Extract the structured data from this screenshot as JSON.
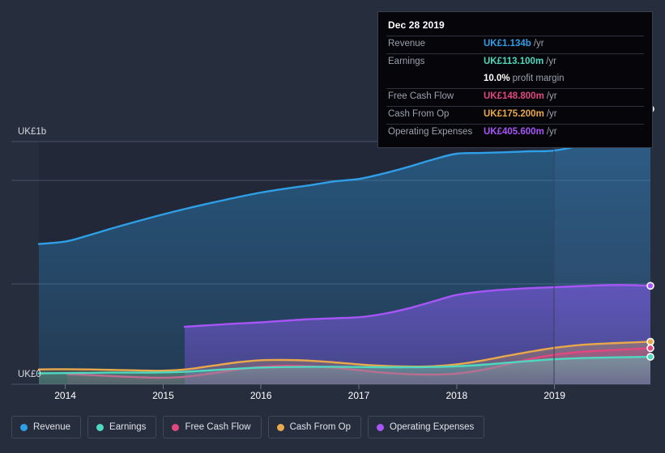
{
  "chart_data": {
    "type": "area",
    "title": "",
    "xlabel": "",
    "ylabel": "",
    "currency": "UK£",
    "x_tick_labels": [
      "2014",
      "2015",
      "2016",
      "2017",
      "2018",
      "2019"
    ],
    "x_tick_values": [
      2014,
      2015,
      2016,
      2017,
      2018,
      2019
    ],
    "y_tick_labels": [
      "UK£0",
      "UK£1b"
    ],
    "y_tick_values": [
      0,
      1000
    ],
    "ylim": [
      0,
      1100
    ],
    "xlim": [
      2013.73,
      2019.98
    ],
    "y_unit": "millions UK£",
    "grid": true,
    "legend_position": "bottom-left",
    "series": [
      {
        "name": "Revenue",
        "color": "#2f9fe8",
        "x": [
          2013.73,
          2014.0,
          2014.25,
          2014.5,
          2014.75,
          2015.0,
          2015.25,
          2015.5,
          2015.75,
          2016.0,
          2016.25,
          2016.5,
          2016.75,
          2017.0,
          2017.25,
          2017.5,
          2017.75,
          2018.0,
          2018.25,
          2018.5,
          2018.75,
          2019.0,
          2019.3,
          2019.65,
          2019.98
        ],
        "values": [
          578,
          588,
          615,
          645,
          673,
          700,
          725,
          748,
          770,
          790,
          806,
          820,
          836,
          846,
          868,
          895,
          925,
          950,
          953,
          956,
          960,
          963,
          990,
          1050,
          1134
        ]
      },
      {
        "name": "Earnings",
        "color": "#4fd8c0",
        "x": [
          2013.73,
          2014.0,
          2014.25,
          2014.5,
          2014.75,
          2015.0,
          2015.25,
          2015.5,
          2015.75,
          2016.0,
          2016.25,
          2016.5,
          2016.75,
          2017.0,
          2017.25,
          2017.5,
          2017.75,
          2018.0,
          2018.25,
          2018.5,
          2018.75,
          2019.0,
          2019.3,
          2019.65,
          2019.98
        ],
        "values": [
          45,
          46,
          47,
          48,
          48,
          49,
          52,
          58,
          64,
          69,
          71,
          72,
          72,
          71,
          70,
          70,
          71,
          74,
          80,
          88,
          96,
          103,
          108,
          111,
          113.1
        ]
      },
      {
        "name": "Free Cash Flow",
        "color": "#e0487f",
        "x": [
          2014.02,
          2014.25,
          2014.5,
          2014.75,
          2015.0,
          2015.25,
          2015.5,
          2015.75,
          2016.0,
          2016.25,
          2016.5,
          2016.75,
          2017.0,
          2017.25,
          2017.5,
          2017.75,
          2018.0,
          2018.25,
          2018.5,
          2018.75,
          2019.0,
          2019.3,
          2019.65,
          2019.98
        ],
        "values": [
          42,
          38,
          33,
          29,
          27,
          32,
          45,
          60,
          72,
          76,
          74,
          68,
          58,
          48,
          42,
          40,
          44,
          58,
          80,
          104,
          122,
          134,
          142,
          148.8
        ]
      },
      {
        "name": "Cash From Op",
        "color": "#e8a84b",
        "x": [
          2013.73,
          2014.0,
          2014.25,
          2014.5,
          2014.75,
          2015.0,
          2015.25,
          2015.5,
          2015.75,
          2016.0,
          2016.25,
          2016.5,
          2016.75,
          2017.0,
          2017.25,
          2017.5,
          2017.75,
          2018.0,
          2018.25,
          2018.5,
          2018.75,
          2019.0,
          2019.3,
          2019.65,
          2019.98
        ],
        "values": [
          61,
          62,
          61,
          59,
          57,
          56,
          62,
          76,
          90,
          99,
          100,
          97,
          90,
          82,
          76,
          73,
          74,
          82,
          97,
          116,
          134,
          150,
          163,
          170,
          175.2
        ]
      },
      {
        "name": "Operating Expenses",
        "color": "#a855f7",
        "x": [
          2015.22,
          2015.5,
          2015.75,
          2016.0,
          2016.25,
          2016.5,
          2016.75,
          2017.0,
          2017.25,
          2017.5,
          2017.75,
          2018.0,
          2018.25,
          2018.5,
          2018.75,
          2019.0,
          2019.3,
          2019.65,
          2019.98
        ],
        "values": [
          237,
          244,
          250,
          255,
          262,
          268,
          272,
          276,
          290,
          312,
          340,
          368,
          382,
          390,
          396,
          400,
          405,
          409,
          405.6
        ]
      }
    ]
  },
  "tooltip": {
    "date": "Dec 28 2019",
    "rows": [
      {
        "label": "Revenue",
        "value": "UK£1.134b",
        "unit": "/yr",
        "color": "#2f9fe8"
      },
      {
        "label": "Earnings",
        "value": "UK£113.100m",
        "unit": "/yr",
        "color": "#4fd8c0"
      },
      {
        "label": "",
        "value": "10.0%",
        "unit": "profit margin",
        "color": "#ffffff"
      },
      {
        "label": "Free Cash Flow",
        "value": "UK£148.800m",
        "unit": "/yr",
        "color": "#e0487f"
      },
      {
        "label": "Cash From Op",
        "value": "UK£175.200m",
        "unit": "/yr",
        "color": "#e8a84b"
      },
      {
        "label": "Operating Expenses",
        "value": "UK£405.600m",
        "unit": "/yr",
        "color": "#a855f7"
      }
    ]
  },
  "legend": {
    "items": [
      {
        "label": "Revenue",
        "color": "#2f9fe8"
      },
      {
        "label": "Earnings",
        "color": "#4fd8c0"
      },
      {
        "label": "Free Cash Flow",
        "color": "#e0487f"
      },
      {
        "label": "Cash From Op",
        "color": "#e8a84b"
      },
      {
        "label": "Operating Expenses",
        "color": "#a855f7"
      }
    ]
  },
  "axes": {
    "y_top_label": "UK£1b",
    "y_zero_label": "UK£0"
  },
  "theme": {
    "background": "#262d3d",
    "plot_background": "#222838",
    "gridline": "#4a5163",
    "tooltip_background": "#06060a"
  }
}
